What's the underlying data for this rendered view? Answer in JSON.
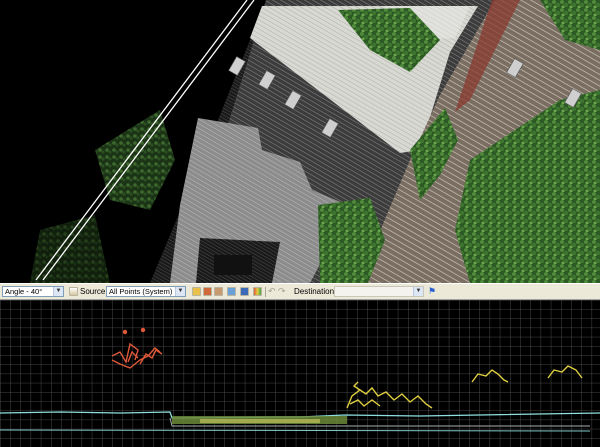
{
  "toolbar": {
    "view_combo_value": "Angle - 40°",
    "source_label": "Source:",
    "source_value": "All Points (System)",
    "destination_label": "Destination:",
    "destination_value": ""
  },
  "icons": {
    "source": "point-cloud-source-icon",
    "tools": [
      "select-icon",
      "invert-selection-icon",
      "hand-icon",
      "classify-icon",
      "layer-icon",
      "palette-icon"
    ],
    "history": [
      "undo-icon",
      "redo-icon"
    ],
    "flag": "flag-icon"
  },
  "colors": {
    "ground_profile": "#8ee0e0",
    "vegetation_high": "#e05a3a",
    "vegetation_mid": "#e0d040",
    "grid": "#5a5a5a",
    "toolbar_bg": "#ece9d8"
  }
}
